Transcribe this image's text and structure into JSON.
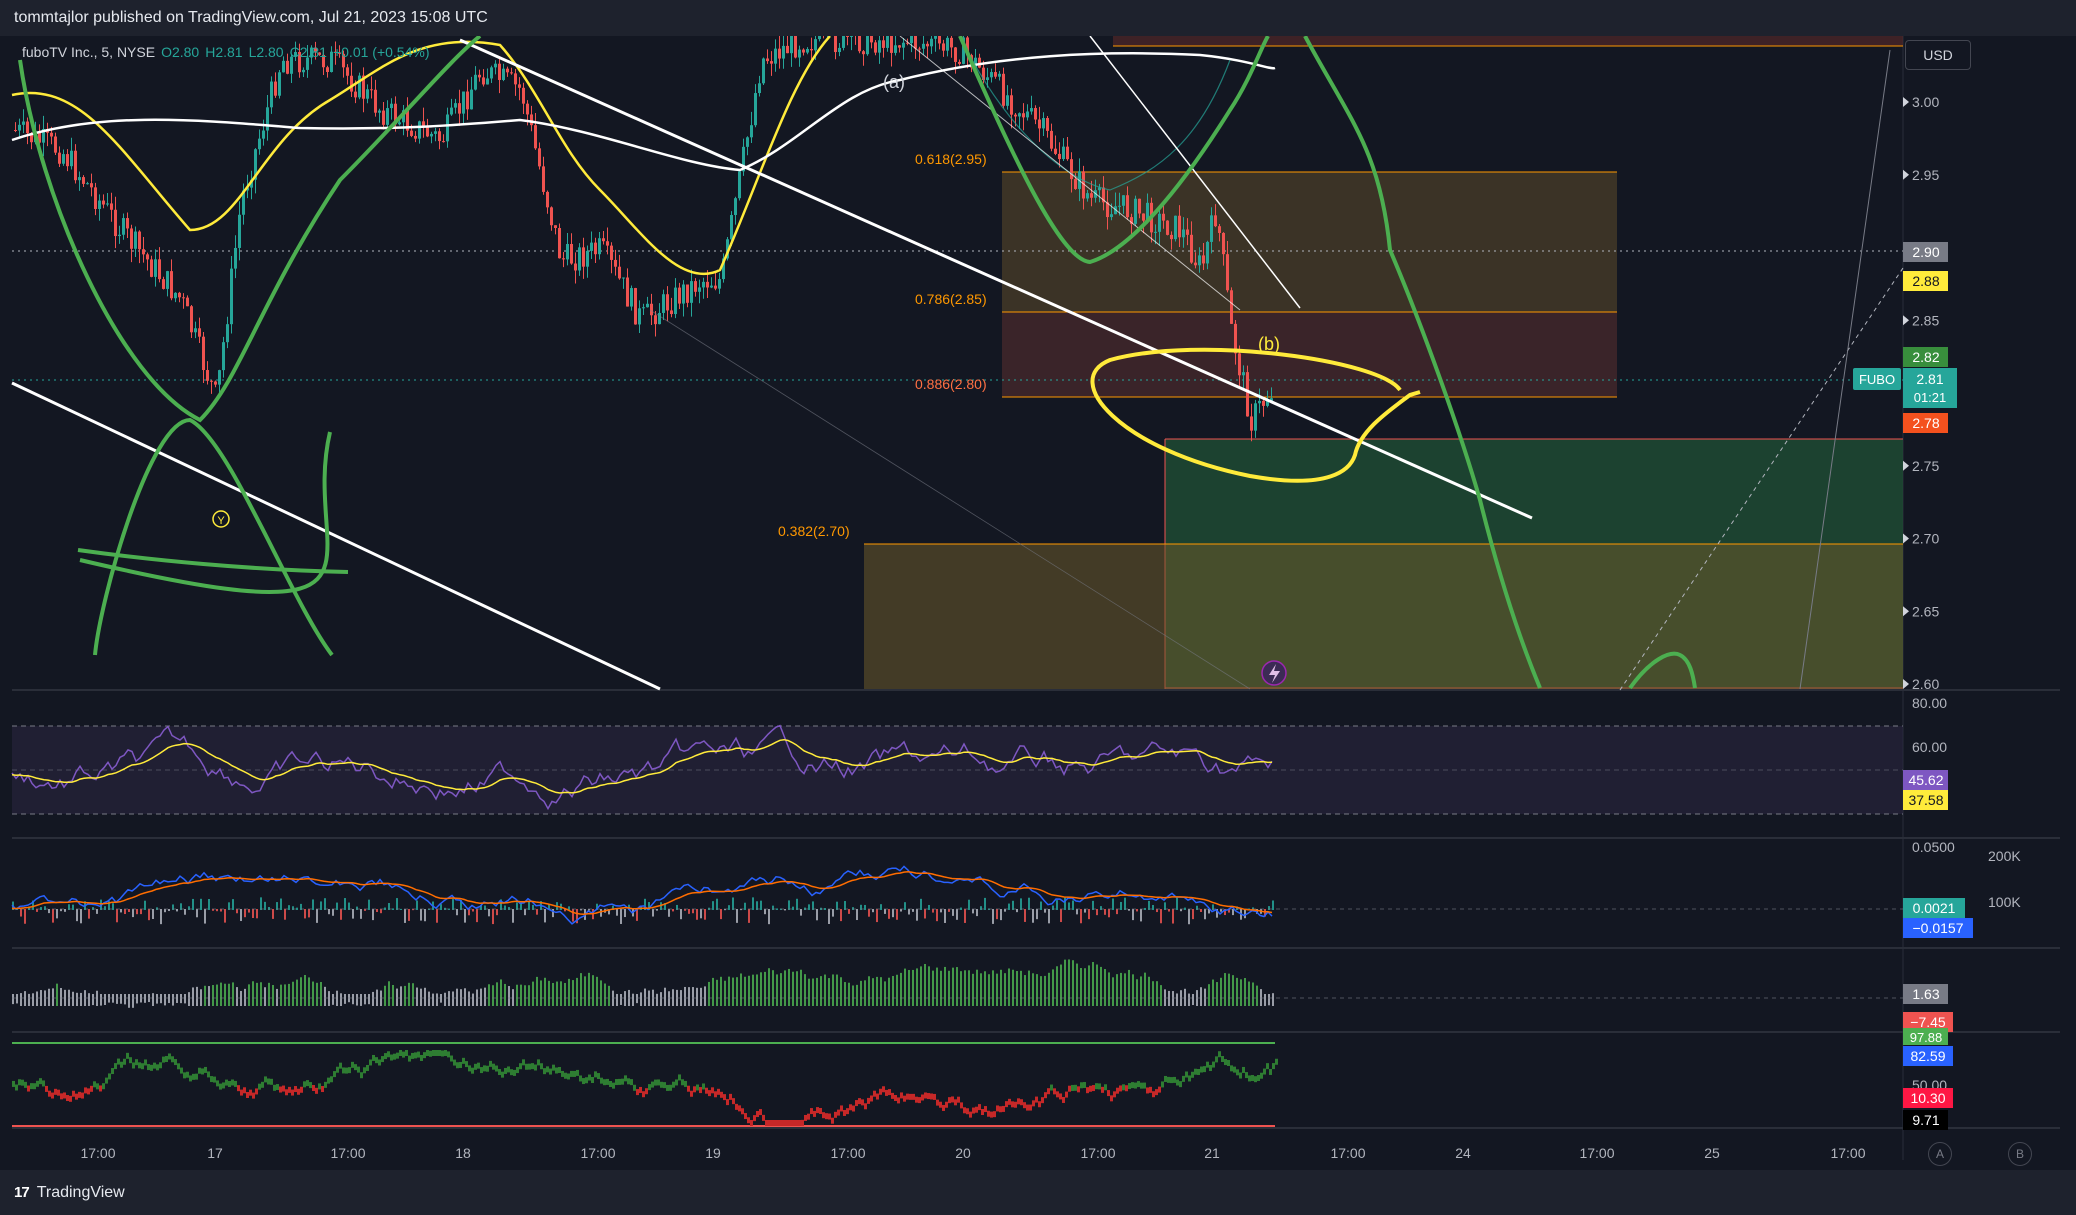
{
  "header": {
    "published_line": "tommtajlor published on TradingView.com, Jul 21, 2023 15:08 UTC"
  },
  "legend": {
    "symbol": "fuboTV Inc., 5, NYSE",
    "o": "O2.80",
    "h": "H2.81",
    "l": "L2.80",
    "c": "C2.81",
    "chg": "+0.01 (+0.54%)"
  },
  "currency_button": "USD",
  "footer": {
    "brand": "TradingView",
    "btn_a": "A",
    "btn_b": "B"
  },
  "price_axis": {
    "ticks": [
      "3.00",
      "2.95",
      "2.90",
      "2.85",
      "2.80",
      "2.75",
      "2.70",
      "2.65",
      "2.60"
    ],
    "badges": {
      "b290": "2.90",
      "b288": "2.88",
      "b282": "2.82",
      "fubo_label": "FUBO",
      "b281": "2.81",
      "countdown": "01:21",
      "b278": "2.78"
    }
  },
  "rsi_axis": {
    "ticks": [
      "80.00",
      "60.00"
    ],
    "rsi_value": "45.62",
    "ma_value": "37.58"
  },
  "macd_axis": {
    "ticks": [
      "0.0500"
    ],
    "vol_ticks": [
      "200K",
      "100K"
    ],
    "v1": "0.0021",
    "v2": "−0.0157"
  },
  "osc_axis": {
    "v1": "1.63",
    "v2": "−7.45"
  },
  "stoch_axis": {
    "ticks": [
      "50.00"
    ],
    "v1": "97.88",
    "v2": "82.59",
    "v3": "10.30",
    "v4": "9.71"
  },
  "time_axis": [
    "17:00",
    "17",
    "17:00",
    "18",
    "17:00",
    "19",
    "17:00",
    "20",
    "17:00",
    "21",
    "17:00",
    "24",
    "17:00",
    "25",
    "17:00"
  ],
  "annotations": {
    "wave_a": "(a)",
    "wave_b": "(b)",
    "wave_y": "Y",
    "fib_0618": "0.618(2.95)",
    "fib_0786": "0.786(2.85)",
    "fib_0886": "0.886(2.80)",
    "fib_0382": "0.382(2.70)"
  },
  "colors": {
    "background": "#131722",
    "up": "#26a69a",
    "down": "#ef5350",
    "drawing_green": "#4caf50",
    "drawing_yellow": "#ffeb3b",
    "rsi": "#7e57c2",
    "fib_orange": "#ff9800"
  },
  "chart_data": {
    "type": "line",
    "title": "",
    "symbol": "fuboTV Inc., 5, NYSE",
    "xlabel": "",
    "ylabel": "",
    "ylim": [
      2.58,
      3.04
    ],
    "x": [
      "17",
      "18",
      "19",
      "20",
      "21"
    ],
    "series": [],
    "price_levels": [
      2.95,
      2.85,
      2.8,
      2.7
    ],
    "last_price": 2.81,
    "grid": false
  }
}
